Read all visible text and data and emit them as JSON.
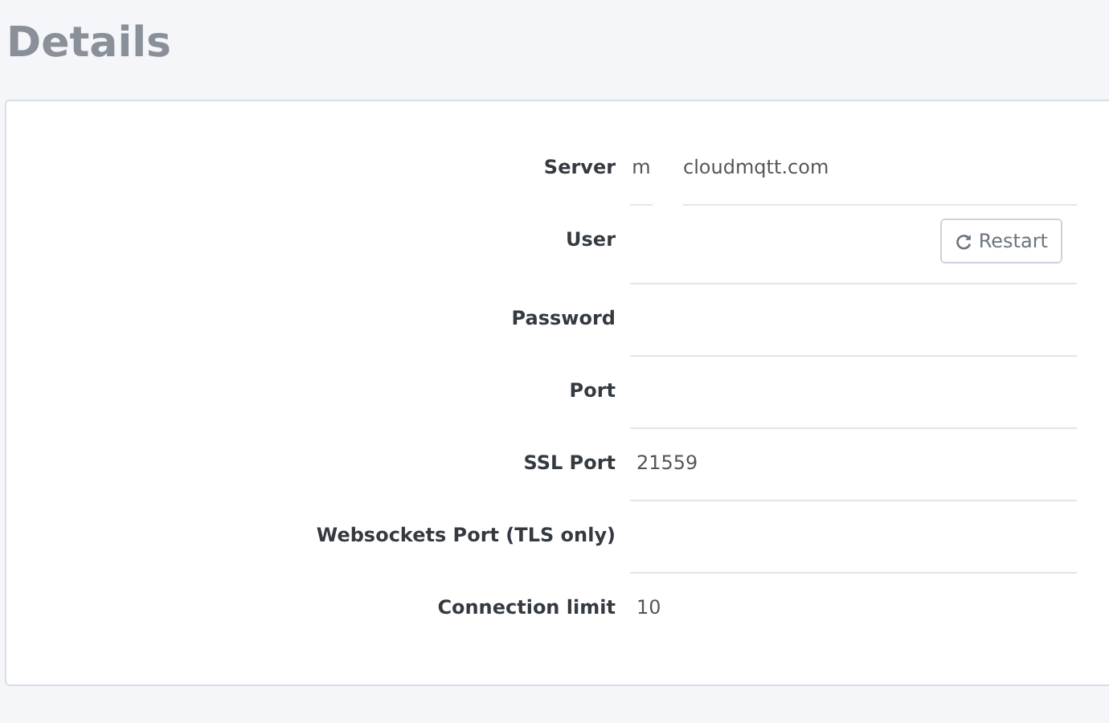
{
  "title": "Details",
  "fields": [
    {
      "label": "Server",
      "values": [
        "m",
        "cloudmqtt.com"
      ]
    },
    {
      "label": "User",
      "action": {
        "label": "Restart"
      }
    },
    {
      "label": "Password"
    },
    {
      "label": "Port"
    },
    {
      "label": "SSL Port",
      "values": [
        "21559"
      ]
    },
    {
      "label": "Websockets Port (TLS only)"
    },
    {
      "label": "Connection limit",
      "values": [
        "10"
      ]
    }
  ]
}
